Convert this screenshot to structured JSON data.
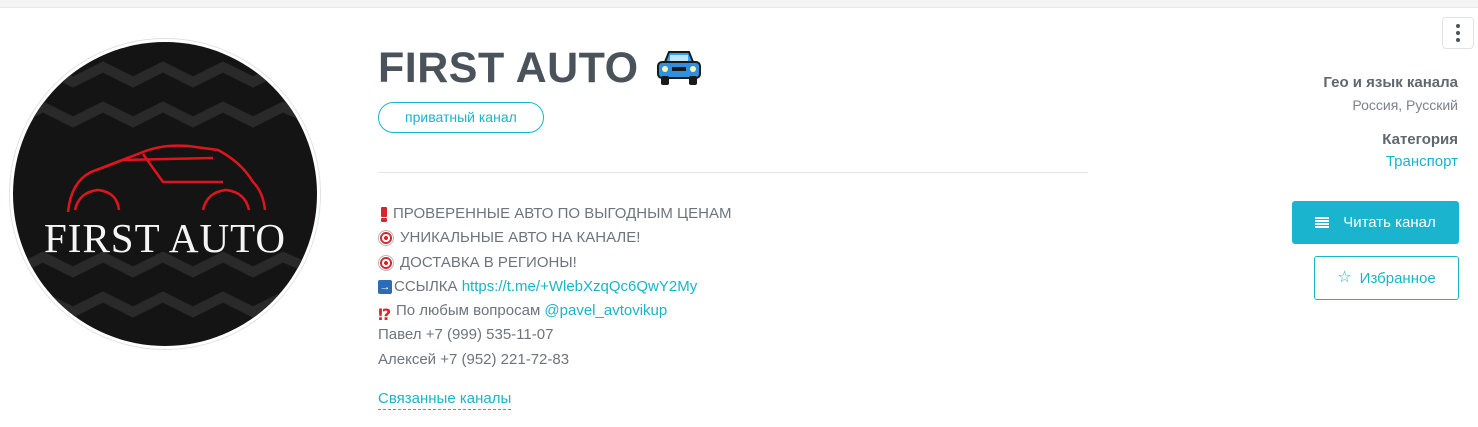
{
  "channel": {
    "title": "FIRST AUTO",
    "title_emoji": "car-icon",
    "badge": "приватный канал",
    "avatar_text": "FIRST AUTO"
  },
  "description": {
    "line1": "ПРОВЕРЕННЫЕ АВТО ПО ВЫГОДНЫМ ЦЕНАМ",
    "line2": "УНИКАЛЬНЫЕ АВТО НА КАНАЛЕ!",
    "line3": "ДОСТАВКА В РЕГИОНЫ!",
    "line4_prefix": "ССЫЛКА ",
    "line4_link": "https://t.me/+WlebXzqQc6QwY2My",
    "line5_prefix": "По любым вопросам ",
    "line5_link": "@pavel_avtovikup",
    "line6": "Павел +7 (999) 535-11-07",
    "line7": "Алексей +7 (952) 221-72-83"
  },
  "related_link": "Связанные каналы",
  "sidebar": {
    "geo_heading": "Гео и язык канала",
    "geo_value": "Россия, Русский",
    "category_heading": "Категория",
    "category_value": "Транспорт",
    "read_button": "Читать канал",
    "favorite_button": "Избранное"
  },
  "colors": {
    "accent": "#1ab4c8",
    "title": "#4a535b",
    "emphasis_red": "#d9262e"
  }
}
